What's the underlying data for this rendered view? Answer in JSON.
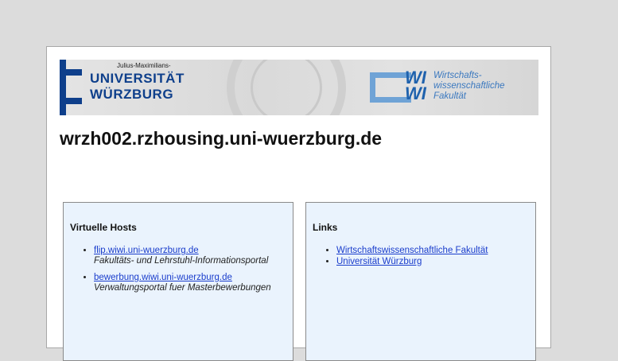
{
  "banner": {
    "uni_small": "Julius-Maximilians-",
    "uni_line1": "UNIVERSITÄT",
    "uni_line2": "WÜRZBURG",
    "wiwi_w1": "WI",
    "wiwi_w2": "WI",
    "wiwi_text": [
      "Wirtschafts-",
      "wissenschaftliche",
      "Fakultät"
    ]
  },
  "hostname": "wrzh002.rzhousing.uni-wuerzburg.de",
  "virtual_hosts": {
    "title": "Virtuelle Hosts",
    "items": [
      {
        "link": "flip.wiwi.uni-wuerzburg.de",
        "desc": "Fakultäts- und Lehrstuhl-Informationsportal"
      },
      {
        "link": "bewerbung.wiwi.uni-wuerzburg.de",
        "desc": "Verwaltungsportal fuer Masterbewerbungen"
      }
    ]
  },
  "links": {
    "title": "Links",
    "items": [
      {
        "link": "Wirtschaftswissenschaftliche Fakultät"
      },
      {
        "link": "Universität Würzburg"
      }
    ]
  },
  "colors": {
    "uni_blue": "#0e3f8b",
    "wiwi_blue": "#1f62ad",
    "panel_bg": "#eaf3fd",
    "link": "#1a3dcc"
  }
}
